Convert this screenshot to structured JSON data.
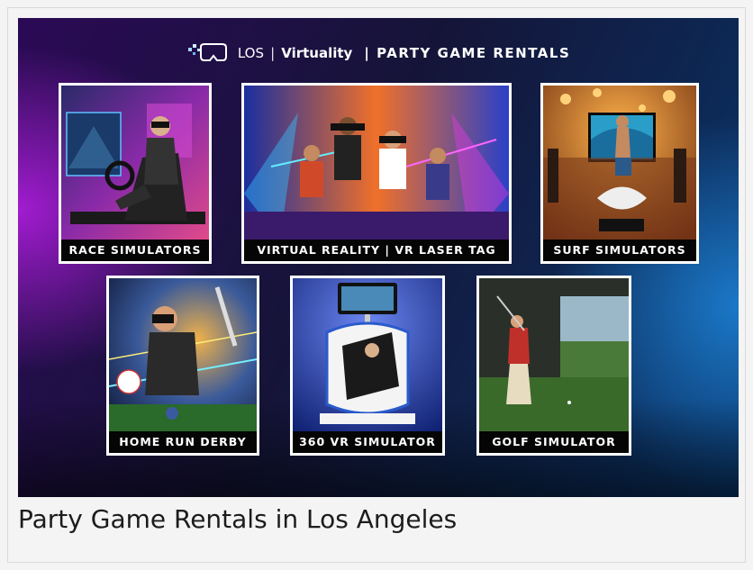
{
  "banner": {
    "brand_los": "LOS",
    "brand_sep": "|",
    "brand_virtuality": "Virtuality",
    "brand_tagline": "| PARTY GAME RENTALS"
  },
  "cards": [
    {
      "label": "RACE SIMULATORS"
    },
    {
      "label": "VIRTUAL REALITY | VR LASER TAG"
    },
    {
      "label": "SURF SIMULATORS"
    },
    {
      "label": "HOME RUN DERBY"
    },
    {
      "label": "360 VR SIMULATOR"
    },
    {
      "label": "GOLF SIMULATOR"
    }
  ],
  "caption": "Party Game Rentals in Los Angeles",
  "colors": {
    "banner_purple": "#2b0a55",
    "banner_blue": "#0a3a72",
    "caption_bar": "#050505",
    "card_border": "#ffffff"
  },
  "icons": [
    "vr-headset-logo-icon"
  ]
}
